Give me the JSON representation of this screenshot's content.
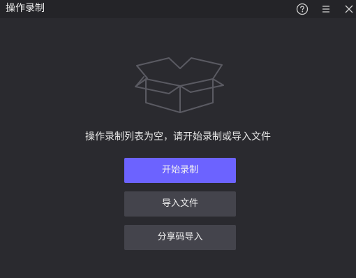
{
  "window": {
    "title": "操作录制"
  },
  "titlebar_icons": {
    "help": "help-circle-icon",
    "menu": "menu-icon",
    "close": "close-icon"
  },
  "empty_state": {
    "icon": "empty-box-icon",
    "message": "操作录制列表为空，请开始录制或导入文件"
  },
  "actions": {
    "start_recording": "开始录制",
    "import_file": "导入文件",
    "share_code_import": "分享码导入"
  },
  "colors": {
    "background": "#2a2a2f",
    "titlebar": "#242428",
    "primary": "#6c63ff",
    "secondary": "#44444c",
    "text": "#e6e6e6"
  }
}
